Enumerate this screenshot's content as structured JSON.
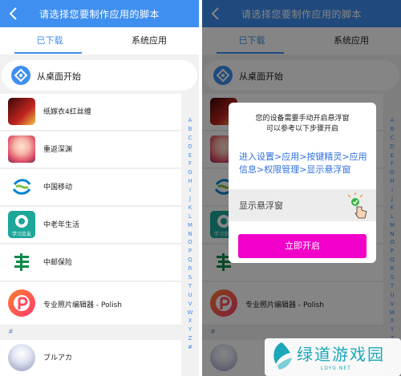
{
  "header": {
    "title": "请选择您要制作应用的脚本"
  },
  "tabs": [
    {
      "label": "已下载",
      "active": true
    },
    {
      "label": "系统应用",
      "active": false
    }
  ],
  "desktop_entry": {
    "label": "从桌面开始"
  },
  "apps": [
    {
      "label": "纸嫁衣4红丝缠",
      "icon": "game-red-icon"
    },
    {
      "label": "重返深渊",
      "icon": "anime-girl-icon"
    },
    {
      "label": "中国移动",
      "icon": "china-mobile-icon"
    },
    {
      "label": "中老年生活",
      "icon": "study-app-icon",
      "icon_text": "学习交友"
    },
    {
      "label": "中邮保险",
      "icon": "postal-insurance-icon"
    },
    {
      "label": "专业照片编辑器 - Polish",
      "icon": "polish-icon"
    }
  ],
  "section_hash": "#",
  "last_app": {
    "label": "ブルアカ",
    "icon": "blue-archive-icon"
  },
  "index_letters": [
    "A",
    "B",
    "C",
    "D",
    "E",
    "F",
    "G",
    "H",
    "I",
    "J",
    "K",
    "L",
    "M",
    "N",
    "O",
    "P",
    "Q",
    "R",
    "S",
    "T",
    "U",
    "V",
    "W",
    "X",
    "Y",
    "Z",
    "#"
  ],
  "dialog": {
    "line1": "您的设备需要手动开启悬浮窗",
    "line2": "可以参考以下步骤开启",
    "steps_line1": "进入设置>应用>按键精灵>应用",
    "steps_line2": "信息>权限管理>显示悬浮窗",
    "switch_label": "显示悬浮窗",
    "button_label": "立即开启"
  },
  "watermark": {
    "text": "绿道游戏园",
    "sub": "LDYG.NET"
  },
  "colors": {
    "accent": "#3f8ff0",
    "button": "#f000c8",
    "watermark": "#1aa7b8"
  }
}
